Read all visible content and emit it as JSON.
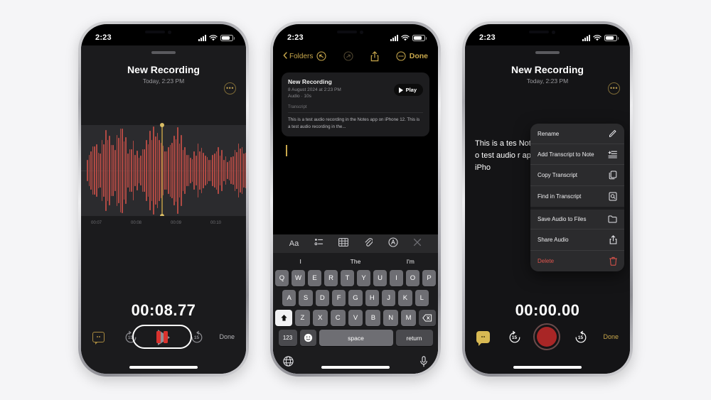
{
  "background_color": "#f5f5f7",
  "accent_gold": "#c9a84c",
  "waveform_color": "#b04a44",
  "record_red": "#a92626",
  "phone1": {
    "status": {
      "time": "2:23",
      "signal": "cellular-bars-icon",
      "wifi": "wifi-icon",
      "battery": "battery-icon"
    },
    "title": "New Recording",
    "subtitle": "Today, 2:23 PM",
    "more_label": "•••",
    "ticks": [
      "00:07",
      "00:08",
      "00:09",
      "00:10"
    ],
    "elapsed": "00:08.77",
    "skip_back": "15",
    "skip_forward": "15",
    "done_label": "Done"
  },
  "phone2": {
    "status": {
      "time": "2:23"
    },
    "toolbar": {
      "back_label": "Folders",
      "undo": "undo-icon",
      "redo": "redo-icon",
      "share": "share-icon",
      "more": "more-icon",
      "done_label": "Done"
    },
    "audio_card": {
      "title": "New Recording",
      "date": "8 August 2024 at 2:23 PM",
      "duration": "Audio · 10s",
      "play_label": "Play",
      "transcript_label": "Transcript",
      "transcript_text": "This is a test audio recording in the Notes app on iPhone 12. This is a test audio recording in the..."
    },
    "keyboard": {
      "tools": [
        "Aa",
        "checklist-icon",
        "table-icon",
        "attachment-icon",
        "markup-icon",
        "close-icon"
      ],
      "suggestions": [
        "I",
        "The",
        "I'm"
      ],
      "row1": [
        "Q",
        "W",
        "E",
        "R",
        "T",
        "Y",
        "U",
        "I",
        "O",
        "P"
      ],
      "row2": [
        "A",
        "S",
        "D",
        "F",
        "G",
        "H",
        "J",
        "K",
        "L"
      ],
      "row3": [
        "Z",
        "X",
        "C",
        "V",
        "B",
        "N",
        "M"
      ],
      "shift": "shift-icon",
      "backspace": "backspace-icon",
      "numbers_label": "123",
      "emoji": "emoji-icon",
      "space_label": "space",
      "return_label": "return",
      "globe": "globe-icon",
      "mic": "microphone-icon"
    }
  },
  "phone3": {
    "status": {
      "time": "2:23"
    },
    "title": "New Recording",
    "subtitle": "Today, 2:23 PM",
    "behind_text": "This is a tes Notes app o test audio r app on iPho",
    "menu": [
      {
        "label": "Rename",
        "icon": "pencil-icon"
      },
      {
        "label": "Add Transcript to Note",
        "icon": "add-text-icon"
      },
      {
        "label": "Copy Transcript",
        "icon": "copy-icon"
      },
      {
        "label": "Find in Transcript",
        "icon": "find-doc-icon"
      },
      {
        "label": "Save Audio to Files",
        "icon": "folder-icon"
      },
      {
        "label": "Share Audio",
        "icon": "share-icon"
      },
      {
        "label": "Delete",
        "icon": "trash-icon"
      }
    ],
    "elapsed": "00:00.00",
    "skip_back": "15",
    "skip_forward": "15",
    "done_label": "Done"
  }
}
